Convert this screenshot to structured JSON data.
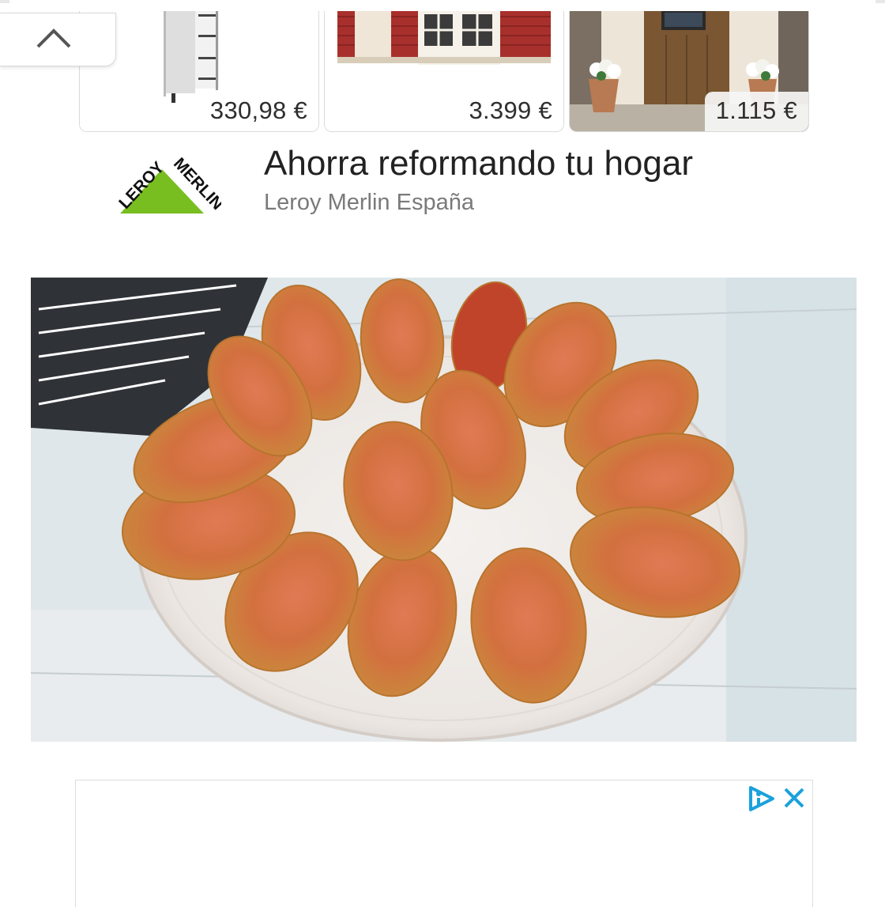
{
  "collapse_button": {
    "icon": "chevron-up-icon"
  },
  "products": [
    {
      "price": "330,98 €",
      "image": "metal-storage-shelf"
    },
    {
      "price": "3.399 €",
      "image": "red-wooden-garden-house"
    },
    {
      "price": "1.115 €",
      "image": "wooden-front-door-with-flower-pots"
    }
  ],
  "ad": {
    "logo_text": "LEROY MERLIN",
    "title": "Ahorra reformando tu hogar",
    "advertiser": "Leroy Merlin España"
  },
  "article_image": {
    "description": "fried-stuffed-peppers-on-plate"
  },
  "bottom_ad": {
    "icons": [
      "adchoices-icon",
      "close-icon"
    ]
  },
  "colors": {
    "leroy_green": "#78be20",
    "text_dark": "#222222",
    "text_gray": "#7a7a7a",
    "adchoices_blue": "#1ba1dc"
  }
}
